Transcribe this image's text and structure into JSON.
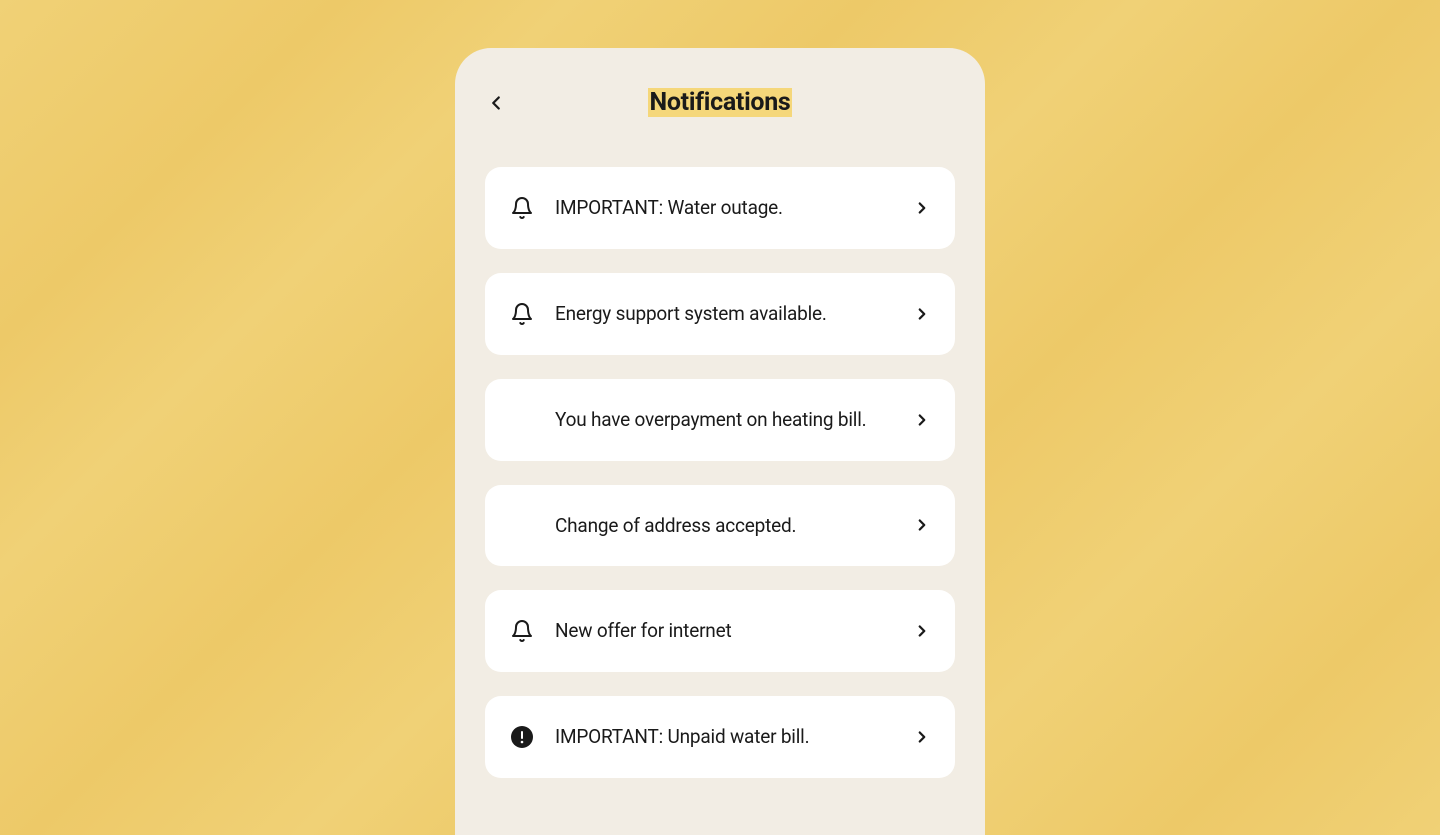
{
  "header": {
    "title": "Notifications"
  },
  "notifications": [
    {
      "icon": "bell",
      "text": "IMPORTANT: Water outage."
    },
    {
      "icon": "bell",
      "text": "Energy support system available."
    },
    {
      "icon": "none",
      "text": "You have overpayment on heating bill."
    },
    {
      "icon": "none",
      "text": "Change of address accepted."
    },
    {
      "icon": "bell",
      "text": "New offer for internet"
    },
    {
      "icon": "alert",
      "text": "IMPORTANT: Unpaid water bill."
    }
  ]
}
